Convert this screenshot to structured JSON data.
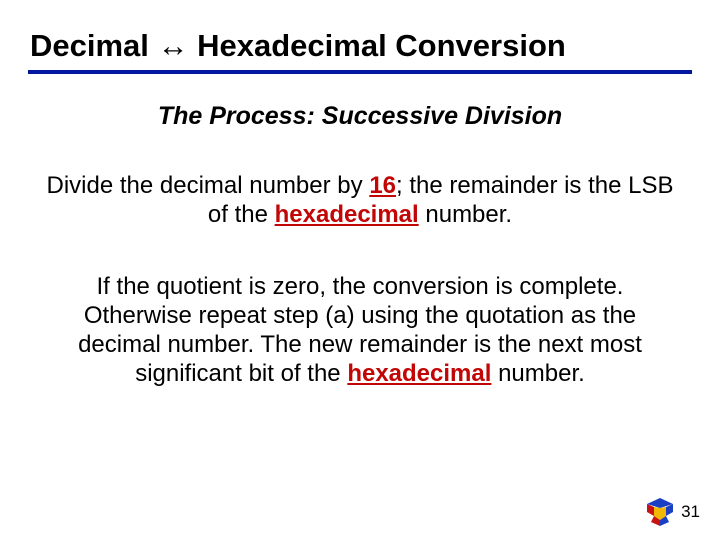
{
  "title": "Decimal ↔ Hexadecimal Conversion",
  "subtitle": "The Process: Successive Division",
  "para1": {
    "pre": "Divide the decimal number by ",
    "num": "16",
    "mid": "; the remainder is the LSB of the ",
    "word": "hexadecimal",
    "post": " number."
  },
  "para2": {
    "pre": "If the quotient is zero, the conversion is complete. Otherwise repeat step (a) using the quotation as the decimal number. The new remainder is the next most significant bit of the ",
    "word": "hexadecimal",
    "post": " number."
  },
  "page_number": "31"
}
